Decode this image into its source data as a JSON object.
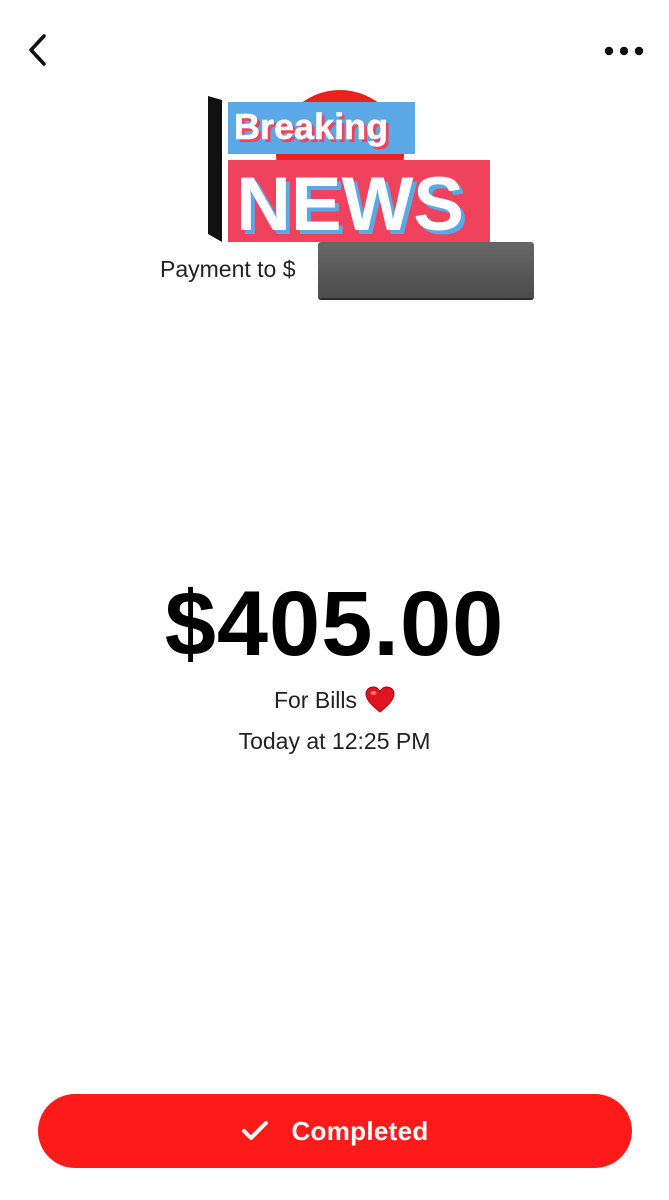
{
  "header": {
    "back_icon": "chevron-left-icon",
    "more_icon": "more-horizontal-icon"
  },
  "banner": {
    "line1": "Breaking",
    "line2": "NEWS"
  },
  "recipient": {
    "prefix": "Payment to $"
  },
  "payment": {
    "amount": "$405.00",
    "note": "For Bills",
    "note_emoji_icon": "red-heart-icon",
    "timestamp": "Today at 12:25 PM"
  },
  "status_button": {
    "label": "Completed",
    "icon": "checkmark-icon",
    "color": "#ff1a1a"
  },
  "colors": {
    "banner_blue": "#5aa8e6",
    "banner_red": "#f0425c",
    "banner_circle": "#e8221e"
  }
}
